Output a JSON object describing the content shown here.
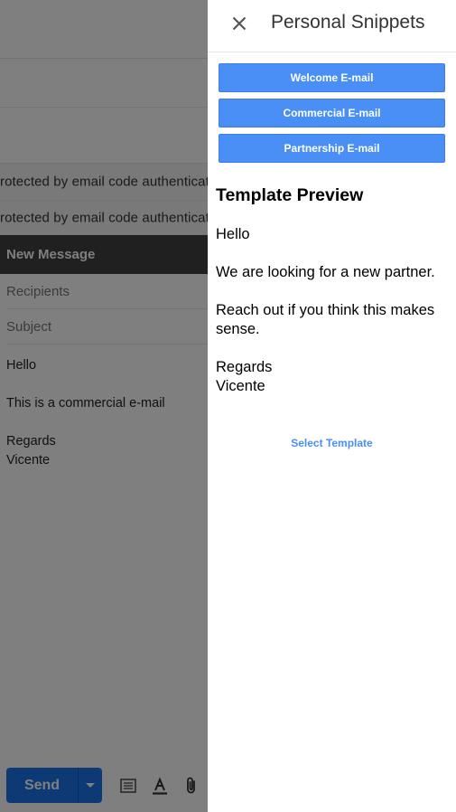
{
  "background": {
    "rows": [
      {
        "snippet": ""
      },
      {
        "snippet": ""
      },
      {
        "snippet": ""
      },
      {
        "snippet": "rotected by email code authentication"
      },
      {
        "snippet": "rotected by email code authentication"
      }
    ],
    "compose": {
      "header": "New Message",
      "recipients_placeholder": "Recipients",
      "subject_placeholder": "Subject",
      "body": [
        "Hello",
        "This is a commercial e-mail",
        "Regards",
        "Vicente"
      ],
      "send_label": "Send",
      "toolbar_icons": [
        "template-icon",
        "text-format-icon",
        "attach-icon"
      ]
    }
  },
  "panel": {
    "title": "Personal Snippets",
    "close_icon": "close-icon",
    "templates": [
      {
        "label": "Welcome E-mail"
      },
      {
        "label": "Commercial E-mail"
      },
      {
        "label": "Partnership E-mail"
      }
    ],
    "preview": {
      "title": "Template Preview",
      "greeting": "Hello",
      "line1": "We are looking for a new partner.",
      "line2": "Reach out if you think this makes sense.",
      "signoff": "Regards",
      "name": "Vicente"
    },
    "select_label": "Select Template"
  },
  "colors": {
    "accent": "#4a8ff5",
    "send": "#1a73e8",
    "compose_header": "#404040"
  }
}
